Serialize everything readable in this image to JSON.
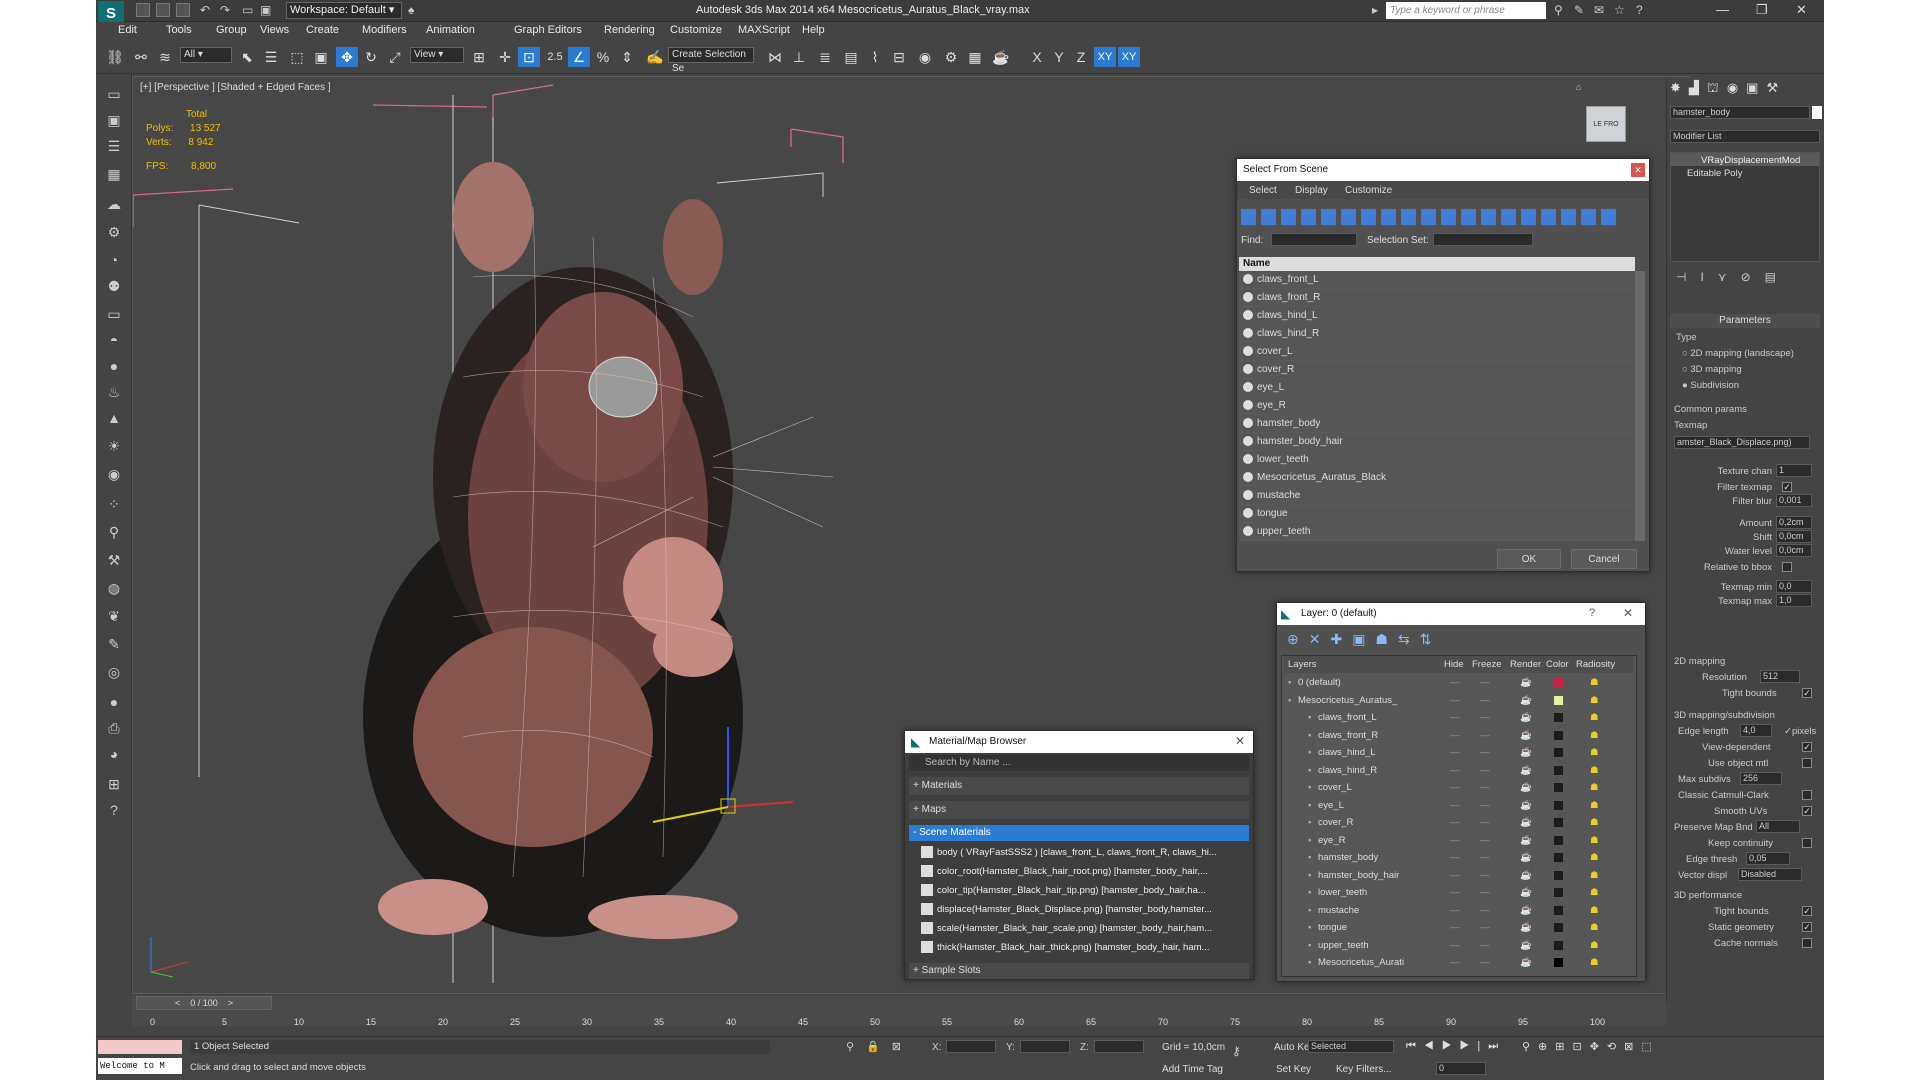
{
  "app": {
    "title": "Autodesk 3ds Max  2014 x64     Mesocricetus_Auratus_Black_vray.max",
    "workspace": "Workspace: Default",
    "search_placeholder": "Type a keyword or phrase"
  },
  "menu": [
    "Edit",
    "Tools",
    "Group",
    "Views",
    "Create",
    "Modifiers",
    "Animation",
    "Graph Editors",
    "Rendering",
    "Customize",
    "MAXScript",
    "Help"
  ],
  "toolbar": {
    "filter": "All",
    "refcoord": "View",
    "snap": "2.5",
    "selset": "Create Selection Se",
    "axes": [
      "X",
      "Y",
      "Z",
      "XY",
      "XY"
    ]
  },
  "viewport": {
    "label": "[+] [Perspective ] [Shaded + Edged Faces ]",
    "stats": {
      "total": "Total",
      "polys_label": "Polys:",
      "polys": "13 527",
      "verts_label": "Verts:",
      "verts": "8 942",
      "fps_label": "FPS:",
      "fps": "8,800"
    }
  },
  "select_dialog": {
    "title": "Select From Scene",
    "menu": [
      "Select",
      "Display",
      "Customize"
    ],
    "find_label": "Find:",
    "selset_label": "Selection Set:",
    "col_name": "Name",
    "items": [
      "claws_front_L",
      "claws_front_R",
      "claws_hind_L",
      "claws_hind_R",
      "cover_L",
      "cover_R",
      "eye_L",
      "eye_R",
      "hamster_body",
      "hamster_body_hair",
      "lower_teeth",
      "Mesocricetus_Auratus_Black",
      "mustache",
      "tongue",
      "upper_teeth"
    ],
    "ok": "OK",
    "cancel": "Cancel"
  },
  "layer_dialog": {
    "title": "Layer: 0 (default)",
    "help": "?",
    "cols": [
      "Layers",
      "Hide",
      "Freeze",
      "Render",
      "Color",
      "Radiosity"
    ],
    "rows": [
      {
        "name": "0 (default)",
        "color": "#c8234a"
      },
      {
        "name": "Mesocricetus_Auratus_",
        "color": "#e8f0a0"
      },
      {
        "name": "claws_front_L",
        "color": "#1c1c1c"
      },
      {
        "name": "claws_front_R",
        "color": "#1c1c1c"
      },
      {
        "name": "claws_hind_L",
        "color": "#1c1c1c"
      },
      {
        "name": "claws_hind_R",
        "color": "#1c1c1c"
      },
      {
        "name": "cover_L",
        "color": "#1c1c1c"
      },
      {
        "name": "eye_L",
        "color": "#1c1c1c"
      },
      {
        "name": "cover_R",
        "color": "#1c1c1c"
      },
      {
        "name": "eye_R",
        "color": "#1c1c1c"
      },
      {
        "name": "hamster_body",
        "color": "#1c1c1c"
      },
      {
        "name": "hamster_body_hair",
        "color": "#1c1c1c"
      },
      {
        "name": "lower_teeth",
        "color": "#1c1c1c"
      },
      {
        "name": "mustache",
        "color": "#1c1c1c"
      },
      {
        "name": "tongue",
        "color": "#1c1c1c"
      },
      {
        "name": "upper_teeth",
        "color": "#1c1c1c"
      },
      {
        "name": "Mesocricetus_Aurati",
        "color": "#000000"
      }
    ]
  },
  "material_browser": {
    "title": "Material/Map Browser",
    "search": "Search by Name ...",
    "groups": [
      "+ Materials",
      "+ Maps",
      "- Scene Materials"
    ],
    "items": [
      "body  ( VRayFastSSS2 )  [claws_front_L, claws_front_R, claws_hi...",
      "color_root(Hamster_Black_hair_root.png) [hamster_body_hair,...",
      "color_tip(Hamster_Black_hair_tip.png) [hamster_body_hair,ha...",
      "displace(Hamster_Black_Displace.png) [hamster_body,hamster...",
      "scale(Hamster_Black_hair_scale.png) [hamster_body_hair,ham...",
      "thick(Hamster_Black_hair_thick.png) [hamster_body_hair, ham..."
    ],
    "sample_slots": "+ Sample Slots"
  },
  "command_panel": {
    "object_name": "hamster_body",
    "modifier_list": "Modifier List",
    "stack": [
      "VRayDisplacementMod",
      "Editable Poly"
    ],
    "params_title": "Parameters",
    "type_label": "Type",
    "types": [
      "2D mapping (landscape)",
      "3D mapping",
      "Subdivision"
    ],
    "common": "Common params",
    "texmap_label": "Texmap",
    "texmap": "amster_Black_Displace.png)",
    "fields": [
      {
        "label": "Texture chan",
        "value": "1"
      },
      {
        "label": "Filter texmap",
        "check": "✓"
      },
      {
        "label": "Filter blur",
        "value": "0,001"
      },
      {
        "label": "Amount",
        "value": "0,2cm"
      },
      {
        "label": "Shift",
        "value": "0,0cm"
      },
      {
        "label": "Water level",
        "value": "0,0cm"
      },
      {
        "label": "Relative to bbox",
        "check": ""
      },
      {
        "label": "Texmap min",
        "value": "0,0"
      },
      {
        "label": "Texmap max",
        "value": "1,0"
      }
    ],
    "map2d": "2D mapping",
    "resolution_label": "Resolution",
    "resolution": "512",
    "tight": "Tight bounds",
    "map3d": "3D mapping/subdivision",
    "edge_len_label": "Edge length",
    "edge_len": "4,0",
    "pixels": "pixels",
    "view_dep": "View-dependent",
    "use_obj": "Use object mtl",
    "max_sub_label": "Max subdivs",
    "max_sub": "256",
    "catmull": "Classic Catmull-Clark",
    "smooth_uv": "Smooth UVs",
    "preserve_label": "Preserve Map Bnd",
    "preserve": "All",
    "keep": "Keep continuity",
    "edge_thresh_label": "Edge thresh",
    "edge_thresh": "0,05",
    "vector_label": "Vector displ",
    "vector": "Disabled",
    "perf": "3D performance",
    "perf_items": [
      "Tight bounds",
      "Static geometry",
      "Cache normals"
    ]
  },
  "timeline": {
    "frame": "0 / 100",
    "ticks": [
      "0",
      "5",
      "10",
      "15",
      "20",
      "25",
      "30",
      "35",
      "40",
      "45",
      "50",
      "55",
      "60",
      "65",
      "70",
      "75",
      "80",
      "85",
      "90",
      "95",
      "100"
    ]
  },
  "status": {
    "welcome": "Welcome to M",
    "selected": "1 Object Selected",
    "hint": "Click and drag to select and move objects",
    "x": "X:",
    "y": "Y:",
    "z": "Z:",
    "grid": "Grid = 10,0cm",
    "add_tag": "Add Time Tag",
    "autokey": "Auto Key",
    "setkey": "Set Key",
    "key_mode": "Selected",
    "key_filters": "Key Filters...",
    "frame": "0"
  }
}
